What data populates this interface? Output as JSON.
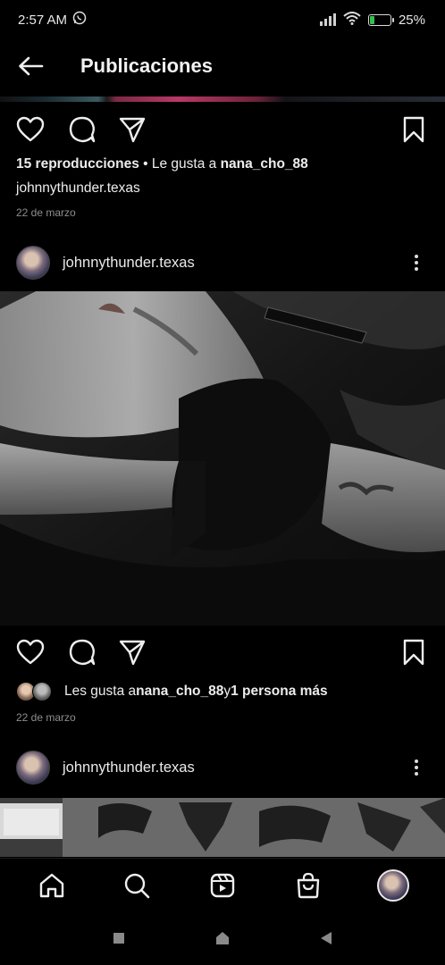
{
  "status_bar": {
    "time": "2:57 AM",
    "battery": "25%",
    "battery_level": 0.25,
    "icons": [
      "whatsapp-icon",
      "signal-icon",
      "wifi-icon",
      "battery-icon"
    ]
  },
  "header": {
    "title": "Publicaciones",
    "back_icon": "arrow-left-icon"
  },
  "post_previous": {
    "views": "15 reproducciones",
    "separator": " • Le gusta a ",
    "liked_by": "nana_cho_88",
    "caption_user": "johnnythunder.texas",
    "date": "22 de marzo"
  },
  "post_main": {
    "username": "johnnythunder.texas",
    "likes_prefix": "Les gusta a ",
    "liked_by": "nana_cho_88",
    "likes_mid": " y ",
    "likes_others": "1 persona más",
    "date": "22 de marzo"
  },
  "post_next": {
    "username": "johnnythunder.texas"
  },
  "bottom_nav": [
    "home-icon",
    "search-icon",
    "reels-icon",
    "shop-icon",
    "profile-avatar"
  ],
  "system_nav": [
    "recents-icon",
    "home-icon",
    "back-icon"
  ],
  "colors": {
    "background": "#000000",
    "text": "#f5f5f5",
    "muted": "#8e8e8e",
    "battery": "#35c04a"
  }
}
